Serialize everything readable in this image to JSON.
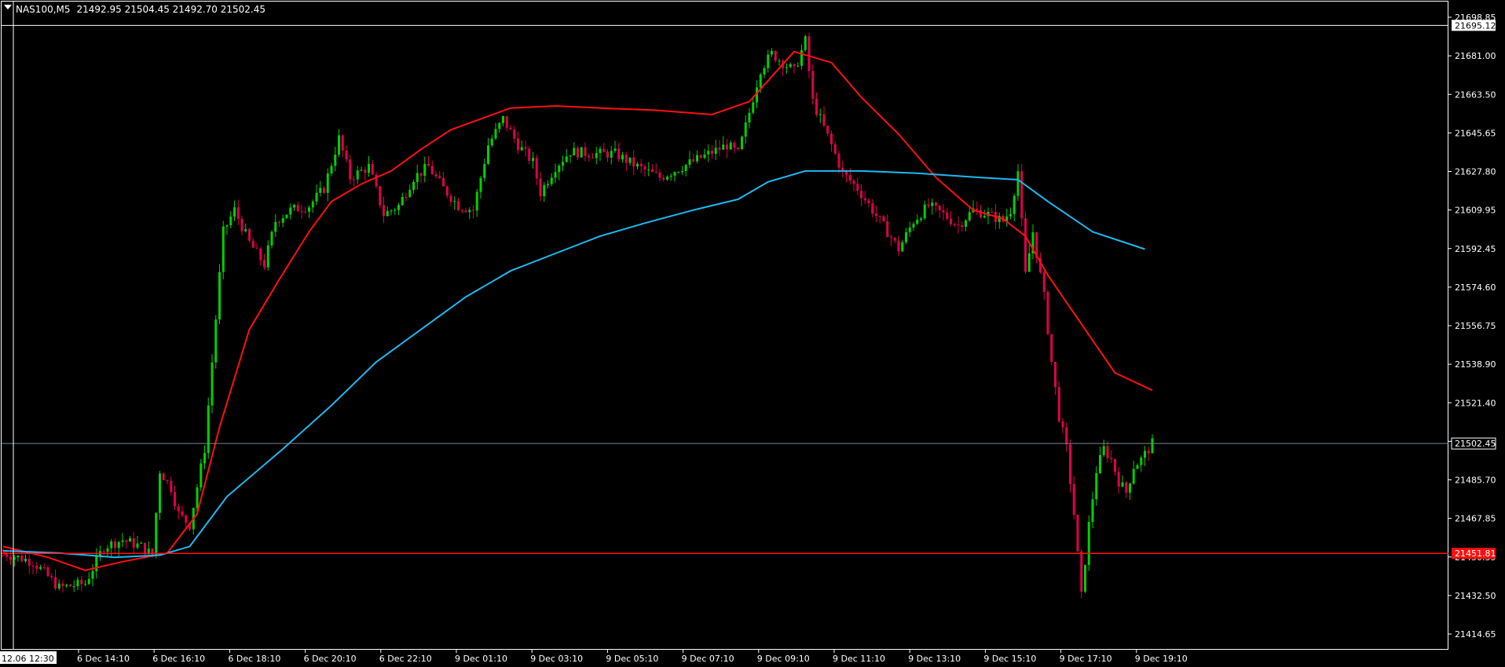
{
  "header": {
    "symbol": "NAS100,M5",
    "ohlc": "21492.95 21504.45 21492.70 21502.45"
  },
  "colors": {
    "background": "#000000",
    "frame": "#ffffff",
    "bull": "#00d000",
    "bear": "#e0004a",
    "ma_fast": "#ff1010",
    "ma_slow": "#20b8f0",
    "hline": "#ff1010",
    "current_price_line": "#7c8a94",
    "text": "#ffffff"
  },
  "markers": {
    "crosshair_time": "12.06 12:30",
    "crosshair_price": "21695.12",
    "current_price": "21502.45",
    "hline_price": "21451.81"
  },
  "chart_data": {
    "type": "candlestick",
    "instrument": "NAS100",
    "timeframe": "M5",
    "x_ticks": [
      "6 Dec 14:10",
      "6 Dec 16:10",
      "6 Dec 18:10",
      "6 Dec 20:10",
      "6 Dec 22:10",
      "9 Dec 01:10",
      "9 Dec 03:10",
      "9 Dec 05:10",
      "9 Dec 07:10",
      "9 Dec 09:10",
      "9 Dec 11:10",
      "9 Dec 13:10",
      "9 Dec 15:10",
      "9 Dec 17:10",
      "9 Dec 19:10"
    ],
    "y_ticks": [
      "21698.85",
      "21681.00",
      "21663.50",
      "21645.65",
      "21627.80",
      "21609.95",
      "21592.45",
      "21574.60",
      "21556.75",
      "21538.90",
      "21521.40",
      "21503.55",
      "21485.70",
      "21467.85",
      "21450.35",
      "21432.50",
      "21414.65"
    ],
    "ylim": [
      21414.65,
      21698.85
    ],
    "price_path": [
      [
        0,
        21452
      ],
      [
        8,
        21448
      ],
      [
        15,
        21436
      ],
      [
        22,
        21438
      ],
      [
        27,
        21455
      ],
      [
        32,
        21458
      ],
      [
        37,
        21455
      ],
      [
        40,
        21451
      ],
      [
        42,
        21490
      ],
      [
        45,
        21482
      ],
      [
        47,
        21470
      ],
      [
        50,
        21465
      ],
      [
        54,
        21500
      ],
      [
        57,
        21560
      ],
      [
        59,
        21600
      ],
      [
        62,
        21610
      ],
      [
        66,
        21595
      ],
      [
        70,
        21585
      ],
      [
        73,
        21605
      ],
      [
        77,
        21610
      ],
      [
        82,
        21612
      ],
      [
        86,
        21620
      ],
      [
        90,
        21643
      ],
      [
        93,
        21625
      ],
      [
        98,
        21630
      ],
      [
        102,
        21608
      ],
      [
        106,
        21612
      ],
      [
        110,
        21625
      ],
      [
        114,
        21630
      ],
      [
        118,
        21620
      ],
      [
        122,
        21612
      ],
      [
        126,
        21610
      ],
      [
        130,
        21640
      ],
      [
        134,
        21652
      ],
      [
        138,
        21640
      ],
      [
        142,
        21632
      ],
      [
        144,
        21618
      ],
      [
        148,
        21630
      ],
      [
        152,
        21637
      ],
      [
        158,
        21636
      ],
      [
        164,
        21636
      ],
      [
        170,
        21630
      ],
      [
        176,
        21625
      ],
      [
        182,
        21630
      ],
      [
        188,
        21635
      ],
      [
        194,
        21640
      ],
      [
        197,
        21636
      ],
      [
        200,
        21655
      ],
      [
        203,
        21675
      ],
      [
        206,
        21682
      ],
      [
        209,
        21678
      ],
      [
        212,
        21674
      ],
      [
        215,
        21688
      ],
      [
        217,
        21660
      ],
      [
        219,
        21652
      ],
      [
        222,
        21640
      ],
      [
        225,
        21627
      ],
      [
        229,
        21620
      ],
      [
        233,
        21610
      ],
      [
        237,
        21600
      ],
      [
        240,
        21592
      ],
      [
        244,
        21605
      ],
      [
        248,
        21612
      ],
      [
        252,
        21608
      ],
      [
        256,
        21603
      ],
      [
        260,
        21610
      ],
      [
        264,
        21608
      ],
      [
        268,
        21605
      ],
      [
        270,
        21610
      ],
      [
        272,
        21628
      ],
      [
        274,
        21580
      ],
      [
        276,
        21600
      ],
      [
        279,
        21570
      ],
      [
        281,
        21540
      ],
      [
        283,
        21515
      ],
      [
        285,
        21500
      ],
      [
        287,
        21470
      ],
      [
        289,
        21432
      ],
      [
        291,
        21465
      ],
      [
        293,
        21490
      ],
      [
        295,
        21500
      ],
      [
        297,
        21495
      ],
      [
        299,
        21485
      ],
      [
        301,
        21480
      ],
      [
        303,
        21492
      ],
      [
        305,
        21495
      ],
      [
        308,
        21502.45
      ]
    ],
    "series": [
      {
        "name": "",
        "type": "moving_average",
        "points": [
          [
            0,
            21455
          ],
          [
            12,
            21450
          ],
          [
            22,
            21444
          ],
          [
            32,
            21448
          ],
          [
            44,
            21452
          ],
          [
            52,
            21470
          ],
          [
            58,
            21510
          ],
          [
            66,
            21555
          ],
          [
            74,
            21578
          ],
          [
            82,
            21600
          ],
          [
            88,
            21614
          ],
          [
            96,
            21622
          ],
          [
            104,
            21628
          ],
          [
            112,
            21638
          ],
          [
            120,
            21647
          ],
          [
            128,
            21652
          ],
          [
            136,
            21657
          ],
          [
            148,
            21658
          ],
          [
            160,
            21657
          ],
          [
            175,
            21656
          ],
          [
            190,
            21654
          ],
          [
            200,
            21660
          ],
          [
            212,
            21683
          ],
          [
            222,
            21678
          ],
          [
            230,
            21662
          ],
          [
            240,
            21645
          ],
          [
            250,
            21625
          ],
          [
            260,
            21610
          ],
          [
            268,
            21606
          ],
          [
            274,
            21598
          ],
          [
            280,
            21580
          ],
          [
            288,
            21560
          ],
          [
            298,
            21535
          ],
          [
            308,
            21527
          ]
        ]
      },
      {
        "name": "",
        "type": "moving_average",
        "points": [
          [
            0,
            21453
          ],
          [
            15,
            21452
          ],
          [
            30,
            21450
          ],
          [
            42,
            21451
          ],
          [
            50,
            21455
          ],
          [
            60,
            21478
          ],
          [
            75,
            21500
          ],
          [
            88,
            21520
          ],
          [
            100,
            21540
          ],
          [
            112,
            21555
          ],
          [
            124,
            21570
          ],
          [
            136,
            21582
          ],
          [
            148,
            21590
          ],
          [
            160,
            21598
          ],
          [
            172,
            21604
          ],
          [
            185,
            21610
          ],
          [
            197,
            21615
          ],
          [
            205,
            21623
          ],
          [
            215,
            21628
          ],
          [
            230,
            21628
          ],
          [
            245,
            21627
          ],
          [
            262,
            21625
          ],
          [
            272,
            21624
          ],
          [
            280,
            21614
          ],
          [
            292,
            21600
          ],
          [
            306,
            21592
          ]
        ]
      }
    ],
    "horizontal_lines": [
      {
        "price": 21451.81,
        "label": "21451.81"
      },
      {
        "price": 21502.45,
        "label": "21502.45"
      }
    ],
    "crosshair": {
      "time": "12.06 12:30",
      "price": 21695.12
    },
    "grid": false
  }
}
